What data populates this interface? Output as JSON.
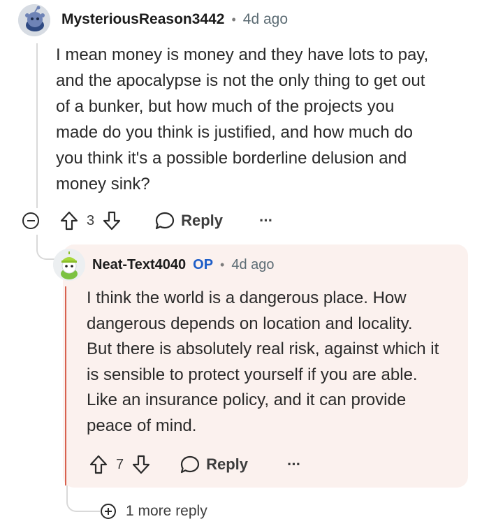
{
  "comment": {
    "username": "MysteriousReason3442",
    "age": "4d ago",
    "body": [
      "I mean money is money and they have lots to pay,",
      "and the apocalypse is not the only thing to get out",
      "of a bunker, but how much of the projects you",
      "made do you think is justified, and how much do",
      "you think it's a possible borderline delusion and",
      "money sink?"
    ],
    "score": "3",
    "reply_label": "Reply",
    "more_label": "···"
  },
  "reply": {
    "username": "Neat-Text4040",
    "op_tag": "OP",
    "age": "4d ago",
    "body": [
      "I think the world is a dangerous place. How",
      "dangerous depends on location and locality.",
      "But there is absolutely real risk, against which it",
      "is sensible to protect yourself if you are able.",
      "Like an insurance policy, and it can provide",
      "peace of mind."
    ],
    "score": "7",
    "reply_label": "Reply",
    "more_label": "···"
  },
  "more_replies_label": "1 more reply",
  "separator": "•",
  "icons": {
    "upvote": "upvote-arrow-icon",
    "downvote": "downvote-arrow-icon",
    "reply": "speech-bubble-icon",
    "collapse": "minus-circle-icon",
    "expand": "plus-circle-icon",
    "avatar1": "reddit-snoo-avatar",
    "avatar2": "green-hat-snoo-avatar"
  },
  "colors": {
    "reply_card_bg": "#fbf1ee",
    "reply_line": "#d8614f",
    "op_tag": "#1e5ec8"
  }
}
